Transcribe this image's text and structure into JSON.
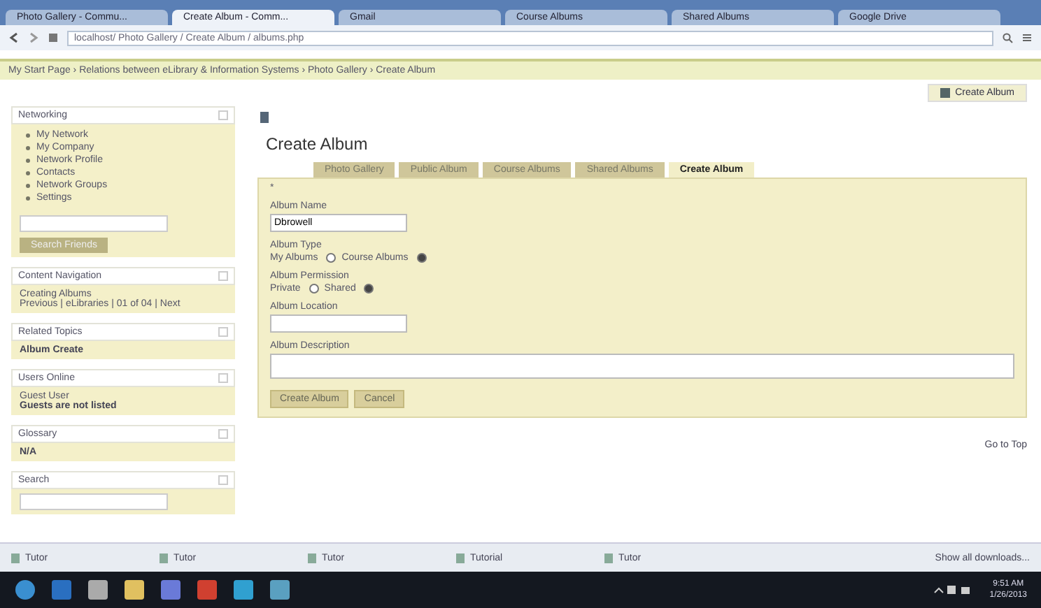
{
  "browser": {
    "tabs": [
      {
        "label": "Photo Gallery - Commu...",
        "selected": false
      },
      {
        "label": "Create Album - Comm...",
        "selected": true
      },
      {
        "label": "Gmail",
        "selected": false
      },
      {
        "label": "Course Albums",
        "selected": false
      },
      {
        "label": "Shared Albums",
        "selected": false
      },
      {
        "label": "Google Drive",
        "selected": false
      }
    ],
    "address": "localhost/ Photo Gallery / Create Album / albums.php",
    "breadcrumb": "My Start Page › Relations between eLibrary & Information Systems › Photo Gallery › Create Album",
    "top_action": "Create Album"
  },
  "sidebar": [
    {
      "title": "Networking",
      "kind": "links",
      "items": [
        "My Network",
        "My Company",
        "Network Profile",
        "Contacts",
        "Network Groups",
        "Settings"
      ],
      "button": "Search Friends"
    },
    {
      "title": "Content Navigation",
      "kind": "nav",
      "lines": [
        "Creating Albums",
        "Previous | eLibraries | 01 of 04 | Next"
      ]
    },
    {
      "title": "Related Topics",
      "kind": "text",
      "lines": [
        "Album Create"
      ]
    },
    {
      "title": "Users Online",
      "kind": "text",
      "lines": [
        "Guest User",
        "Guests are not listed"
      ]
    },
    {
      "title": "Glossary",
      "kind": "text",
      "lines": [
        "N/A"
      ]
    },
    {
      "title": "Search",
      "kind": "empty"
    }
  ],
  "main": {
    "title": "Create Album",
    "tabs": [
      {
        "label": "Photo Gallery",
        "selected": false
      },
      {
        "label": "Public Album",
        "selected": false
      },
      {
        "label": "Course Albums",
        "selected": false
      },
      {
        "label": "Shared Albums",
        "selected": false
      },
      {
        "label": "Create Album",
        "selected": true
      }
    ],
    "marker": "*",
    "fields": [
      {
        "kind": "text",
        "label": "Album Name",
        "value": "Dbrowell"
      },
      {
        "kind": "radio",
        "label": "Album Type",
        "options": [
          {
            "label": "My Albums",
            "selected": false
          },
          {
            "label": "Course Albums",
            "selected": true
          }
        ]
      },
      {
        "kind": "radio",
        "label": "Album Permission",
        "options": [
          {
            "label": "Private",
            "selected": false
          },
          {
            "label": "Shared",
            "selected": true
          }
        ]
      },
      {
        "kind": "text",
        "label": "Album Location"
      },
      {
        "kind": "textarea",
        "label": "Album Description"
      }
    ],
    "buttons": [
      "Create Album",
      "Cancel"
    ],
    "footer_link": "Go to Top"
  },
  "downloads": {
    "items": [
      "Tutor",
      "Tutor",
      "Tutor",
      "Tutorial",
      "Tutor"
    ],
    "show_all": "Show all downloads..."
  },
  "taskbar": {
    "time": "9:51 AM",
    "date": "1/26/2013"
  }
}
